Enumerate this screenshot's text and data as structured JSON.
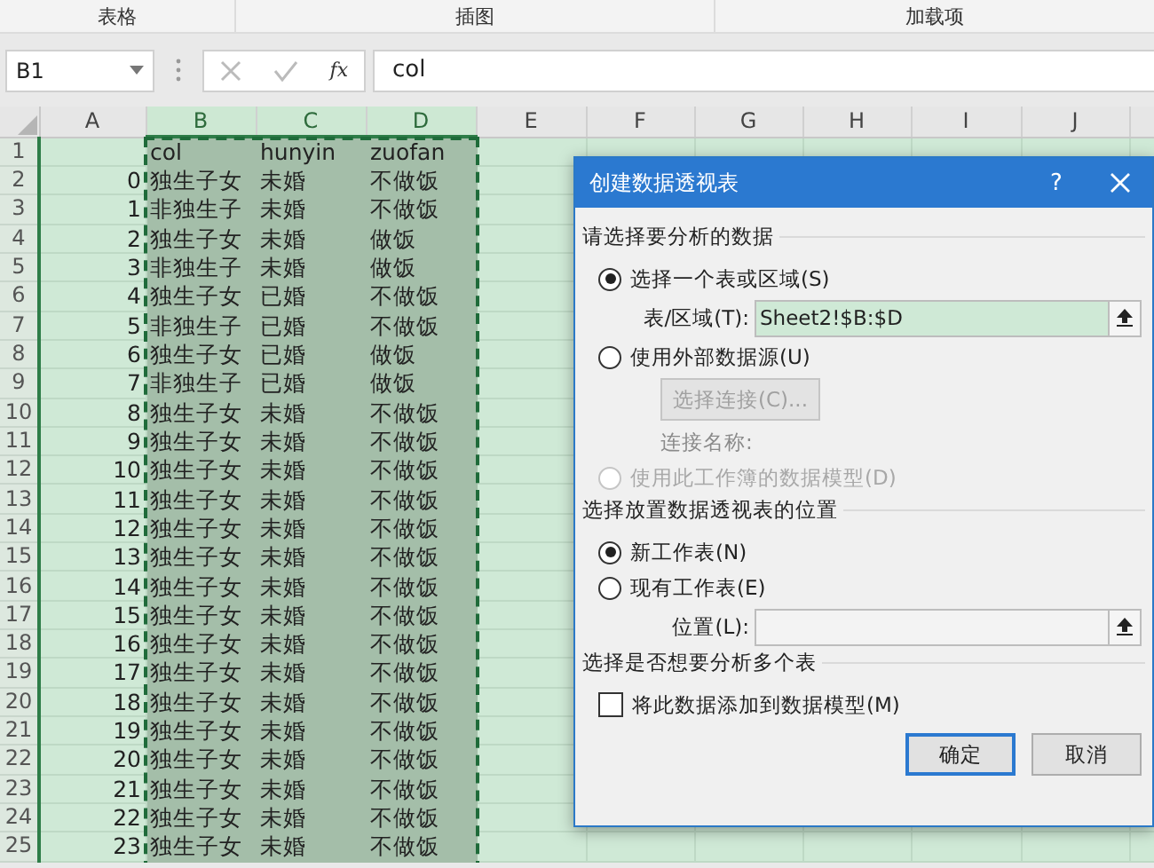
{
  "ribbon_groups": [
    "表格",
    "插图",
    "加载项"
  ],
  "formula_bar": {
    "name_box": "B1",
    "function_symbol": "fx",
    "value": "col"
  },
  "sheet": {
    "columns": [
      {
        "label": "A",
        "selected": false
      },
      {
        "label": "B",
        "selected": true
      },
      {
        "label": "C",
        "selected": true
      },
      {
        "label": "D",
        "selected": true
      },
      {
        "label": "E",
        "selected": false
      },
      {
        "label": "F",
        "selected": false
      },
      {
        "label": "G",
        "selected": false
      },
      {
        "label": "H",
        "selected": false
      },
      {
        "label": "I",
        "selected": false
      },
      {
        "label": "J",
        "selected": false
      }
    ],
    "rows": [
      {
        "number": "1",
        "b": "col",
        "c": "hunyin",
        "d": "zuofan"
      },
      {
        "number": "2",
        "a": "0",
        "b": "独生子女",
        "c": "未婚",
        "d": "不做饭"
      },
      {
        "number": "3",
        "a": "1",
        "b": "非独生子",
        "c": "未婚",
        "d": "不做饭"
      },
      {
        "number": "4",
        "a": "2",
        "b": "独生子女",
        "c": "未婚",
        "d": "做饭"
      },
      {
        "number": "5",
        "a": "3",
        "b": "非独生子",
        "c": "未婚",
        "d": "做饭"
      },
      {
        "number": "6",
        "a": "4",
        "b": "独生子女",
        "c": "已婚",
        "d": "不做饭"
      },
      {
        "number": "7",
        "a": "5",
        "b": "非独生子",
        "c": "已婚",
        "d": "不做饭"
      },
      {
        "number": "8",
        "a": "6",
        "b": "独生子女",
        "c": "已婚",
        "d": "做饭"
      },
      {
        "number": "9",
        "a": "7",
        "b": "非独生子",
        "c": "已婚",
        "d": "做饭"
      },
      {
        "number": "10",
        "a": "8",
        "b": "独生子女",
        "c": "未婚",
        "d": "不做饭"
      },
      {
        "number": "11",
        "a": "9",
        "b": "独生子女",
        "c": "未婚",
        "d": "不做饭"
      },
      {
        "number": "12",
        "a": "10",
        "b": "独生子女",
        "c": "未婚",
        "d": "不做饭"
      },
      {
        "number": "13",
        "a": "11",
        "b": "独生子女",
        "c": "未婚",
        "d": "不做饭"
      },
      {
        "number": "14",
        "a": "12",
        "b": "独生子女",
        "c": "未婚",
        "d": "不做饭"
      },
      {
        "number": "15",
        "a": "13",
        "b": "独生子女",
        "c": "未婚",
        "d": "不做饭"
      },
      {
        "number": "16",
        "a": "14",
        "b": "独生子女",
        "c": "未婚",
        "d": "不做饭"
      },
      {
        "number": "17",
        "a": "15",
        "b": "独生子女",
        "c": "未婚",
        "d": "不做饭"
      },
      {
        "number": "18",
        "a": "16",
        "b": "独生子女",
        "c": "未婚",
        "d": "不做饭"
      },
      {
        "number": "19",
        "a": "17",
        "b": "独生子女",
        "c": "未婚",
        "d": "不做饭"
      },
      {
        "number": "20",
        "a": "18",
        "b": "独生子女",
        "c": "未婚",
        "d": "不做饭"
      },
      {
        "number": "21",
        "a": "19",
        "b": "独生子女",
        "c": "未婚",
        "d": "不做饭"
      },
      {
        "number": "22",
        "a": "20",
        "b": "独生子女",
        "c": "未婚",
        "d": "不做饭"
      },
      {
        "number": "23",
        "a": "21",
        "b": "独生子女",
        "c": "未婚",
        "d": "不做饭"
      },
      {
        "number": "24",
        "a": "22",
        "b": "独生子女",
        "c": "未婚",
        "d": "不做饭"
      },
      {
        "number": "25",
        "a": "23",
        "b": "独生子女",
        "c": "未婚",
        "d": "不做饭"
      }
    ]
  },
  "dialog": {
    "title": "创建数据透视表",
    "help": "?",
    "sections": [
      {
        "title": "请选择要分析的数据",
        "items": [
          {
            "kind": "radio",
            "label": "选择一个表或区域(S)",
            "selected": true,
            "disabled": false
          },
          {
            "kind": "field",
            "label": "表/区域(T):",
            "value": "Sheet2!$B:$D"
          },
          {
            "kind": "radio",
            "label": "使用外部数据源(U)",
            "selected": false,
            "disabled": false
          },
          {
            "kind": "button",
            "label": "选择连接(C)...",
            "disabled": true
          },
          {
            "kind": "text",
            "label": "连接名称:",
            "disabled": true
          },
          {
            "kind": "radio",
            "label": "使用此工作簿的数据模型(D)",
            "selected": false,
            "disabled": true
          }
        ]
      },
      {
        "title": "选择放置数据透视表的位置",
        "items": [
          {
            "kind": "radio",
            "label": "新工作表(N)",
            "selected": true,
            "disabled": false
          },
          {
            "kind": "radio",
            "label": "现有工作表(E)",
            "selected": false,
            "disabled": false
          },
          {
            "kind": "field",
            "label": "位置(L):"
          }
        ]
      },
      {
        "title": "选择是否想要分析多个表",
        "items": [
          {
            "kind": "checkbox",
            "label": "将此数据添加到数据模型(M)",
            "checked": false
          }
        ]
      }
    ],
    "buttons": [
      {
        "label": "确定",
        "default": true
      },
      {
        "label": "取消",
        "default": false
      }
    ]
  }
}
